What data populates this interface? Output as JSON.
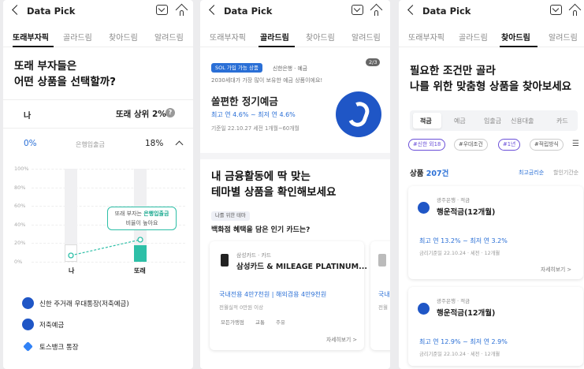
{
  "colors": {
    "accent_blue": "#2a6fd6",
    "accent_teal": "#2dbfa7",
    "brand_blue": "#1f56c6",
    "purple": "#6a4fd8"
  },
  "header": {
    "title": "Data Pick",
    "back_icon": "chevron-left-icon",
    "icon_1": "inbox-icon",
    "icon_2": "home-icon"
  },
  "tabs": [
    "또래부자픽",
    "골라드림",
    "찾아드림",
    "알려드림"
  ],
  "screen1": {
    "headline_1": "또래 부자들은",
    "headline_2": "어떤 상품을 선택할까?",
    "me_label": "나",
    "rank_label": "또래 상위 2%",
    "stat_left": "0%",
    "stat_mid": "은행입출금",
    "stat_right": "18%",
    "chart_data": {
      "type": "bar",
      "categories": [
        "나",
        "또래"
      ],
      "values": [
        0,
        18
      ],
      "ylim": [
        0,
        100
      ],
      "yticks": [
        "100%",
        "80%",
        "60%",
        "40%",
        "20%",
        "0%"
      ]
    },
    "bubble_line_1": "또래 부자는 ",
    "bubble_highlight": "은행입출금",
    "bubble_line_2": "비율이 높아요",
    "products": [
      "신한 주거래 우대통장(저축예금)",
      "저축예금",
      "토스뱅크 통장"
    ]
  },
  "screen2": {
    "badge_sol": "SOL 가입 가능 상품",
    "bank_meta": "신한은행 · 예금",
    "page_counter": "2/3",
    "subtitle": "2030세대가 가장 많이 보유한 예금 상품이에요!",
    "product_title": "쏠편한 정기예금",
    "rate": "최고 연 4.6% ~ 최저 연 4.6%",
    "rate_meta": "기준일 22.10.27 세전 1개월~60개월",
    "section_title_1": "내 금융활동에 딱 맞는",
    "section_title_2": "테마별 상품을 확인해보세요",
    "theme_chip": "나를 위한 테마",
    "theme_headline": "백화점 혜택을 담은 인기 카드는?",
    "card_meta": "삼성카드 · 카드",
    "card_title": "삼성카드 & MILEAGE PLATINUM...",
    "card_benefit": "국내전용 4만7천원 | 해외겸용 4만9천원",
    "card_condition": "전월실적 0만원 이상",
    "card_tags": [
      "모든가맹점",
      "교통",
      "주유"
    ],
    "detail_link": "자세히보기 >",
    "peek_1": "국내",
    "peek_2": "전월"
  },
  "screen3": {
    "headline_1": "필요한 조건만 골라",
    "headline_2": "나를 위한 맞춤형 상품을 찾아보세요",
    "category_tabs": [
      "적금",
      "예금",
      "입출금",
      "신용대출",
      "카드"
    ],
    "filter_chips": [
      "#신한 외18",
      "#우대조건",
      "#1년",
      "#적립방식"
    ],
    "filter_icon": "sliders-icon",
    "count_label": "상품 ",
    "count_value": "207건",
    "sort_active": "최고금리순",
    "sort_other": "할인기간순",
    "products": [
      {
        "meta": "광주은행 · 적금",
        "name": "행운적금(12개월)",
        "rate": "최고 연 13.2% ~ 최저 연 3.2%",
        "date": "금리기준일 22.10.24 · 세전 · 12개월"
      },
      {
        "meta": "광주은행 · 적금",
        "name": "행운적금(12개월)",
        "rate": "최고 연 12.9% ~ 최저 연 2.9%",
        "date": "금리기준일 22.10.24 · 세전 · 12개월"
      }
    ],
    "detail_link": "자세히보기 >"
  }
}
